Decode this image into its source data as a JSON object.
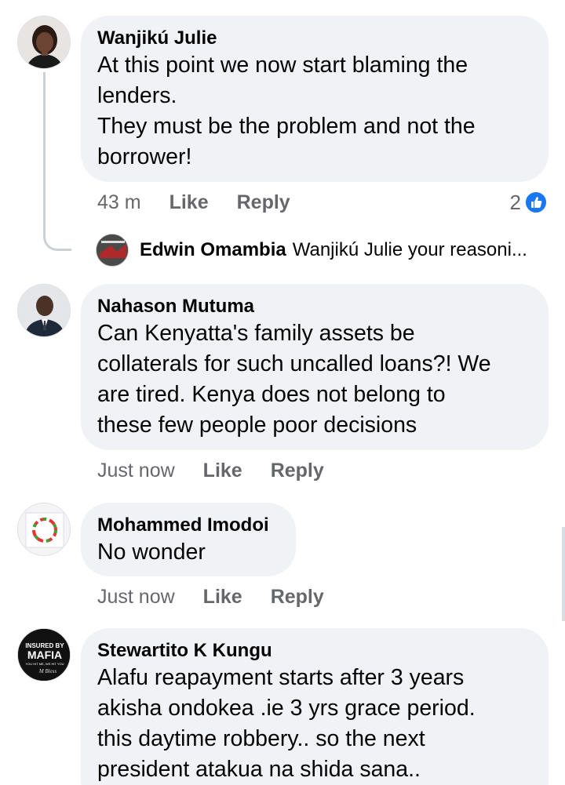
{
  "comments": [
    {
      "author": "Wanjikú Julie",
      "lines": [
        "At this point we now start blaming the",
        "lenders.",
        "They must be the problem and not the",
        "borrower!"
      ],
      "time": "43 m",
      "like": "Like",
      "reply": "Reply",
      "reaction_count": "2"
    },
    {
      "author": "Nahason Mutuma",
      "lines": [
        "Can Kenyatta's family assets be",
        "collaterals for such uncalled loans?! We",
        "are tired. Kenya does not belong to",
        "these few people poor decisions"
      ],
      "time": "Just now",
      "like": "Like",
      "reply": "Reply"
    },
    {
      "author": "Mohammed Imodoi",
      "lines": [
        "No wonder"
      ],
      "time": "Just now",
      "like": "Like",
      "reply": "Reply"
    },
    {
      "author": "Stewartito K Kungu",
      "lines": [
        "Alafu reapayment starts after 3 years",
        "akisha ondokea .ie 3 yrs grace period.",
        "this daytime robbery.. so the next",
        "president atakua na shida sana.."
      ]
    }
  ],
  "reply_preview": {
    "author": "Edwin Omambia",
    "text": "Wanjikú Julie your reasoni..."
  },
  "avatar_4_badge": {
    "line1": "INSURED BY",
    "line2": "MAFIA",
    "line3": "YOU HIT ME, WE HIT YOU",
    "line4": "M Bless"
  },
  "colors": {
    "bubble": "#f0f2f5",
    "secondary_text": "#65676b",
    "like_blue": "#1877f2"
  }
}
